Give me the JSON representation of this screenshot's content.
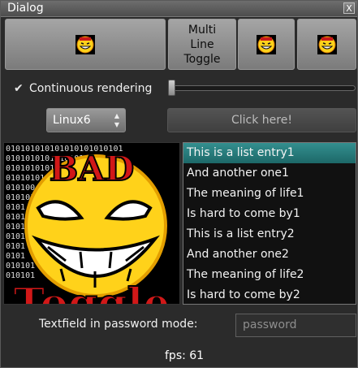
{
  "window": {
    "title": "Dialog",
    "close_label": "X"
  },
  "toolbar": {
    "multiline_toggle_label_lines": [
      "Multi",
      "Line",
      "Toggle"
    ]
  },
  "controls": {
    "continuous_rendering_label": "Continuous rendering",
    "continuous_rendering_checked": true,
    "slider_value": 0,
    "spinbox_value": "Linux6",
    "click_button_label": "Click here!"
  },
  "image_panel": {
    "headline": "BAD",
    "footer_text": "Toggle",
    "binary_rows": [
      "010101010101010101010101",
      "010101010101010101010101",
      "0101010101",
      "0101010101",
      "010100",
      "010101",
      "0101",
      "0101",
      "0101",
      "0101",
      "0101",
      "0101",
      "010101",
      "010101"
    ]
  },
  "list": {
    "items": [
      "This is a list entry1",
      "And another one1",
      "The meaning of life1",
      "Is hard to come by1",
      "This is a list entry2",
      "And another one2",
      "The meaning of life2",
      "Is hard to come by2"
    ],
    "selected_index": 0
  },
  "password": {
    "label": "Textfield in password mode:",
    "placeholder": "password"
  },
  "status": {
    "fps": "fps: 61"
  },
  "colors": {
    "selection": "#2a7d7d",
    "smiley": "#ffd21a",
    "headline_red": "#d11818"
  }
}
